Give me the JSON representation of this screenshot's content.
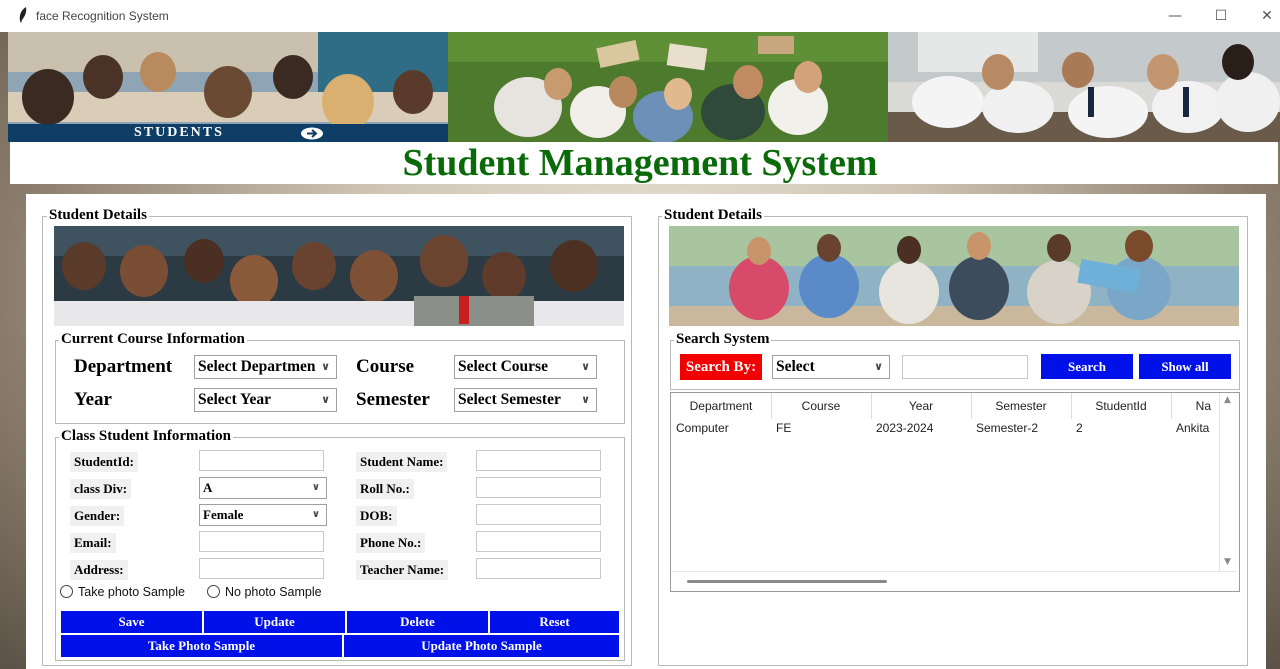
{
  "window": {
    "title": "face Recognition System"
  },
  "banner": {
    "students_label": "STUDENTS"
  },
  "heading": "Student Management System",
  "left": {
    "frame_title": "Student Details",
    "course_frame_title": "Current Course Information",
    "department_label": "Department",
    "department_value": "Select Departmen",
    "course_label": "Course",
    "course_value": "Select Course",
    "year_label": "Year",
    "year_value": "Select Year",
    "semester_label": "Semester",
    "semester_value": "Select Semester",
    "class_frame_title": "Class Student Information",
    "studentid_label": "StudentId:",
    "student_name_label": "Student Name:",
    "class_div_label": "class Div:",
    "class_div_value": "A",
    "roll_label": "Roll No.:",
    "gender_label": "Gender:",
    "gender_value": "Female",
    "dob_label": "DOB:",
    "email_label": "Email:",
    "phone_label": "Phone No.:",
    "address_label": "Address:",
    "teacher_label": "Teacher Name:",
    "radio_take": "Take photo Sample",
    "radio_no": "No photo Sample",
    "buttons": {
      "save": "Save",
      "update": "Update",
      "delete": "Delete",
      "reset": "Reset",
      "take_photo": "Take Photo Sample",
      "update_photo": "Update Photo Sample"
    }
  },
  "right": {
    "frame_title": "Student Details",
    "search_frame_title": "Search System",
    "search_by_label": "Search By:",
    "search_select_value": "Select",
    "search_button": "Search",
    "show_all_button": "Show all",
    "table": {
      "headers": [
        "Department",
        "Course",
        "Year",
        "Semester",
        "StudentId",
        "Na"
      ],
      "rows": [
        [
          "Computer",
          "FE",
          "2023-2024",
          "Semester-2",
          "2",
          "Ankita"
        ]
      ]
    }
  },
  "colors": {
    "heading": "#0a6a0a",
    "button": "#0010e8",
    "search_by": "#f20000"
  }
}
